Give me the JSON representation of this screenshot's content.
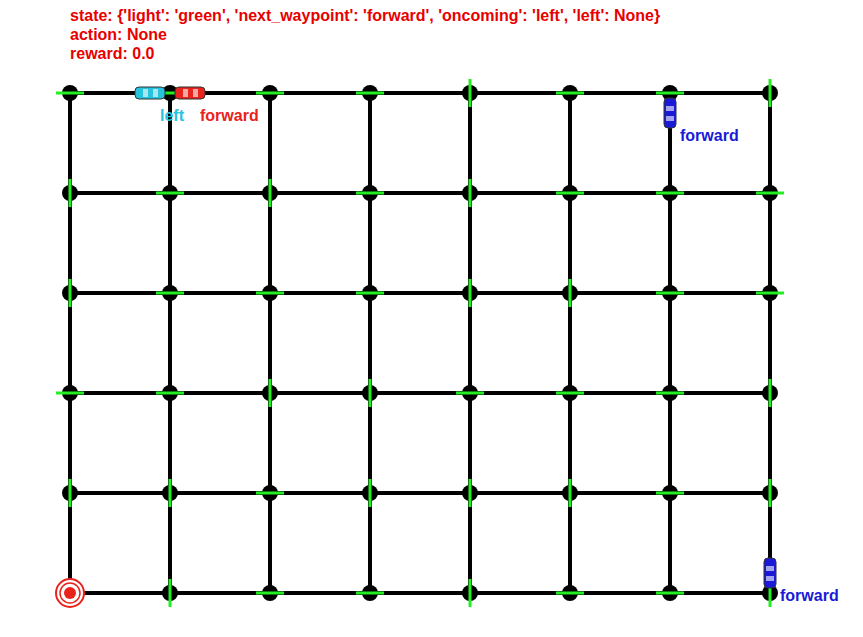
{
  "header": {
    "state": "state: {'light': 'green', 'next_waypoint': 'forward', 'oncoming': 'left', 'left': None}",
    "action": "action: None",
    "reward": "reward: 0.0"
  },
  "grid": {
    "columns": 8,
    "rows": 6,
    "lights": [
      [
        "horizontal",
        "horizontal",
        "horizontal",
        "horizontal",
        "vertical",
        "horizontal",
        "horizontal",
        "vertical"
      ],
      [
        "vertical",
        "horizontal",
        "vertical",
        "horizontal",
        "vertical",
        "horizontal",
        "horizontal",
        "horizontal"
      ],
      [
        "vertical",
        "horizontal",
        "horizontal",
        "horizontal",
        "vertical",
        "vertical",
        "horizontal",
        "horizontal"
      ],
      [
        "horizontal",
        "horizontal",
        "vertical",
        "vertical",
        "horizontal",
        "horizontal",
        "horizontal",
        "vertical"
      ],
      [
        "vertical",
        "vertical",
        "horizontal",
        "vertical",
        "vertical",
        "vertical",
        "horizontal",
        "vertical"
      ],
      [
        "none",
        "vertical",
        "horizontal",
        "horizontal",
        "vertical",
        "horizontal",
        "horizontal",
        "vertical"
      ]
    ]
  },
  "destination": {
    "col": 0,
    "row": 5,
    "color": "#e8231b"
  },
  "cars": [
    {
      "label": "left",
      "color": "#26c3dc",
      "col": 0.8,
      "row": 0,
      "heading": "horizontal"
    },
    {
      "label": "forward",
      "color": "#e8231b",
      "col": 1.2,
      "row": 0,
      "heading": "horizontal"
    },
    {
      "label": "forward",
      "color": "#1a1ad6",
      "col": 6,
      "row": 0.2,
      "heading": "vertical"
    },
    {
      "label": "forward",
      "color": "#1a1ad6",
      "col": 7,
      "row": 4.8,
      "heading": "vertical"
    }
  ]
}
